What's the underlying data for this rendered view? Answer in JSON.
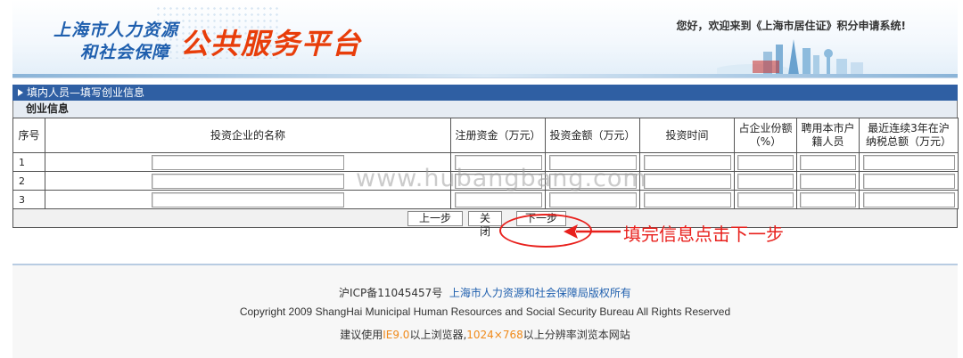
{
  "header": {
    "logo_line1": "上海市人力资源",
    "logo_line2": "和社会保障",
    "logo_platform": "公共服务平台",
    "greeting": "您好，欢迎来到《上海市居住证》积分申请系统!"
  },
  "form": {
    "title": "填内人员—填写创业信息",
    "section": "创业信息",
    "columns": [
      {
        "l1": "序号"
      },
      {
        "l1": "投资企业的名称"
      },
      {
        "l1": "注册资金（万元）"
      },
      {
        "l1": "投资金额（万元）"
      },
      {
        "l1": "投资时间"
      },
      {
        "l1": "占企业份额",
        "l2": "（%）"
      },
      {
        "l1": "聘用本市户",
        "l2": "籍人员"
      },
      {
        "l1": "最近连续3年在沪",
        "l2": "纳税总额（万元）"
      }
    ],
    "rows": [
      {
        "no": "1"
      },
      {
        "no": "2"
      },
      {
        "no": "3"
      }
    ],
    "buttons": {
      "prev": "上一步",
      "close": "关 闭",
      "next": "下一步"
    }
  },
  "overlay": {
    "watermark": "www.hubangbang.com",
    "annotation": "填完信息点击下一步"
  },
  "footer": {
    "icp": "沪ICP备11045457号",
    "owner": "上海市人力资源和社会保障局版权所有",
    "copyright": "Copyright 2009 ShangHai Municipal Human Resources and Social Security Bureau All Rights Reserved",
    "tip_a": "建议使用",
    "tip_ie": "IE9.0",
    "tip_b": "以上浏览器,",
    "tip_res": "1024×768",
    "tip_c": "以上分辨率浏览本网站"
  },
  "colors": {
    "title_bar": "#2f5fa3",
    "annotation": "#e8201c",
    "logo_blue": "#1f5fae",
    "logo_orange": "#e83d0a"
  }
}
